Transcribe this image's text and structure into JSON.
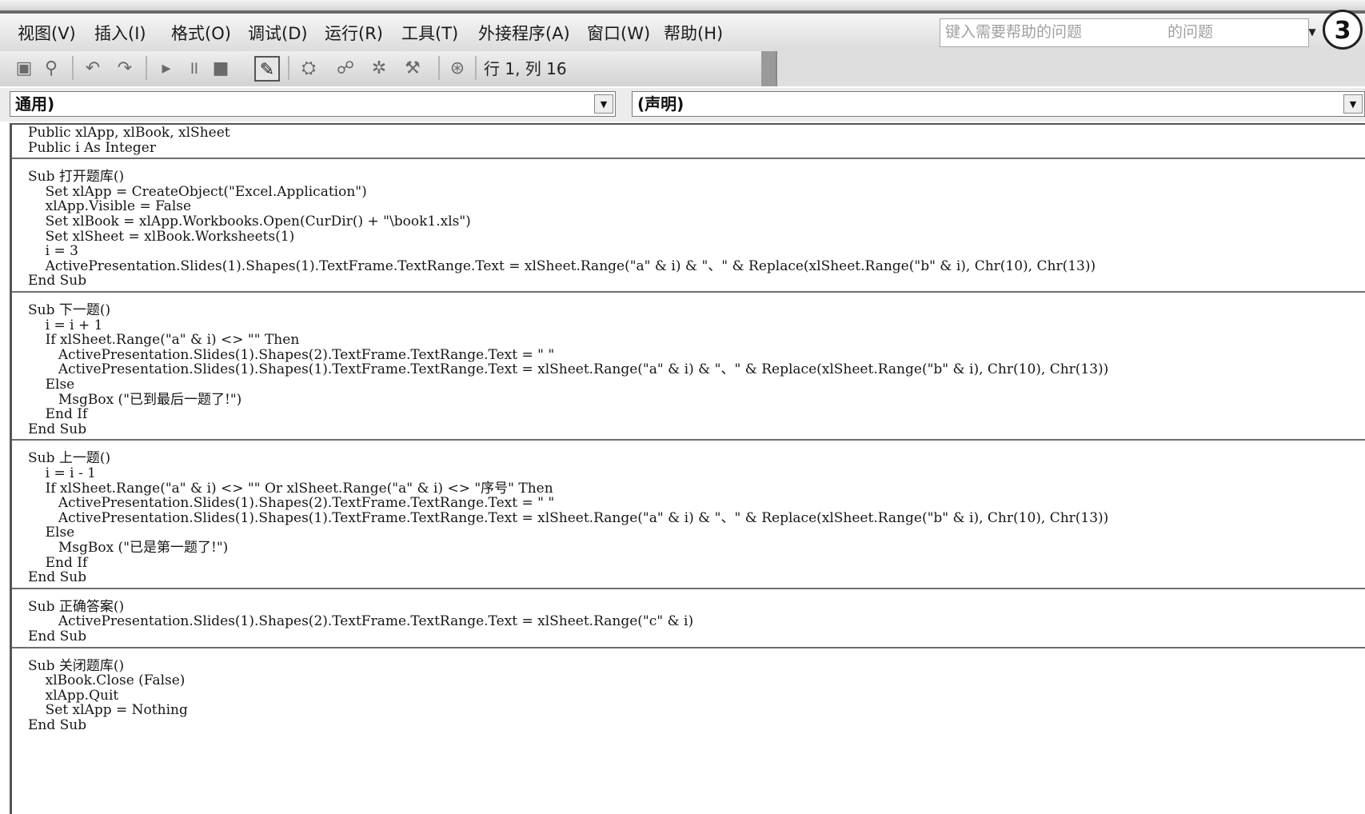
{
  "menu": [
    "视图(V)",
    "插入(I)",
    "格式(O)",
    "调试(D)",
    "运行(R)",
    "工具(T)",
    "外接程序(A)",
    "窗口(W)",
    "帮助(H)"
  ],
  "help": {
    "placeholder": "键入需要帮助的问题",
    "question": "的问题"
  },
  "badge": "3",
  "toolbar": {
    "icons": [
      "save-icon",
      "find-icon",
      "undo-icon",
      "redo-icon",
      "run-icon",
      "break-icon",
      "reset-icon",
      "design-mode-icon",
      "project-explorer-icon",
      "properties-icon",
      "object-browser-icon",
      "toolbox-icon",
      "help-icon"
    ],
    "cursor_position": "行 1, 列 16"
  },
  "object_combo": "通用)",
  "procedure_combo": "(声明)",
  "code": [
    "Public xlApp, xlBook, xlSheet",
    "Public i As Integer",
    "---",
    "Sub 打开题库()",
    "    Set xlApp = CreateObject(\"Excel.Application\")",
    "    xlApp.Visible = False",
    "    Set xlBook = xlApp.Workbooks.Open(CurDir() + \"\\book1.xls\")",
    "    Set xlSheet = xlBook.Worksheets(1)",
    "    i = 3",
    "    ActivePresentation.Slides(1).Shapes(1).TextFrame.TextRange.Text = xlSheet.Range(\"a\" & i) & \"、\" & Replace(xlSheet.Range(\"b\" & i), Chr(10), Chr(13))",
    "End Sub",
    "---",
    "Sub 下一题()",
    "    i = i + 1",
    "    If xlSheet.Range(\"a\" & i) <> \"\" Then",
    "       ActivePresentation.Slides(1).Shapes(2).TextFrame.TextRange.Text = \" \"",
    "       ActivePresentation.Slides(1).Shapes(1).TextFrame.TextRange.Text = xlSheet.Range(\"a\" & i) & \"、\" & Replace(xlSheet.Range(\"b\" & i), Chr(10), Chr(13))",
    "    Else",
    "       MsgBox (\"已到最后一题了!\")",
    "    End If",
    "End Sub",
    "---",
    "Sub 上一题()",
    "    i = i - 1",
    "    If xlSheet.Range(\"a\" & i) <> \"\" Or xlSheet.Range(\"a\" & i) <> \"序号\" Then",
    "       ActivePresentation.Slides(1).Shapes(2).TextFrame.TextRange.Text = \" \"",
    "       ActivePresentation.Slides(1).Shapes(1).TextFrame.TextRange.Text = xlSheet.Range(\"a\" & i) & \"、\" & Replace(xlSheet.Range(\"b\" & i), Chr(10), Chr(13))",
    "    Else",
    "       MsgBox (\"已是第一题了!\")",
    "    End If",
    "End Sub",
    "---",
    "Sub 正确答案()",
    "       ActivePresentation.Slides(1).Shapes(2).TextFrame.TextRange.Text = xlSheet.Range(\"c\" & i)",
    "End Sub",
    "---",
    "Sub 关闭题库()",
    "    xlBook.Close (False)",
    "    xlApp.Quit",
    "    Set xlApp = Nothing",
    "End Sub"
  ]
}
